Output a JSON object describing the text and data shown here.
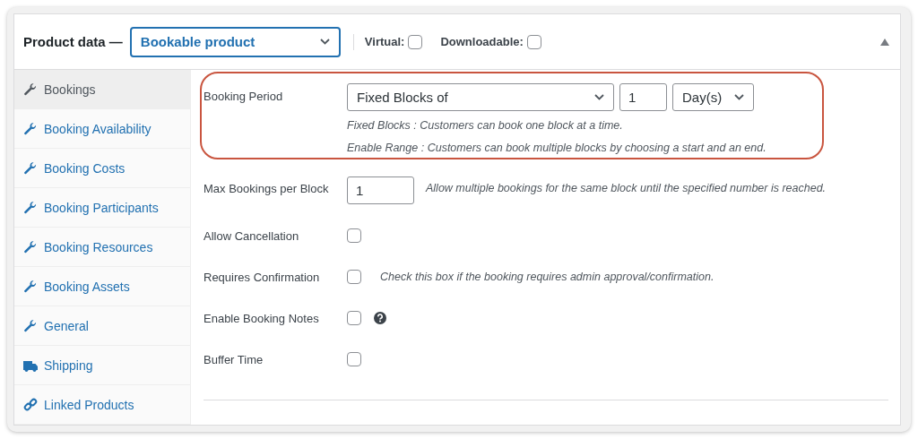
{
  "header": {
    "title": "Product data —",
    "product_type": "Bookable product",
    "options": [
      {
        "label": "Virtual:",
        "checked": false
      },
      {
        "label": "Downloadable:",
        "checked": false
      }
    ],
    "expanded": true
  },
  "sidebar": {
    "items": [
      {
        "label": "Bookings",
        "kind": "wrench",
        "selected": true
      },
      {
        "label": "Booking Availability",
        "kind": "wrench",
        "selected": false
      },
      {
        "label": "Booking Costs",
        "kind": "wrench",
        "selected": false
      },
      {
        "label": "Booking Participants",
        "kind": "wrench",
        "selected": false
      },
      {
        "label": "Booking Resources",
        "kind": "wrench",
        "selected": false
      },
      {
        "label": "Booking Assets",
        "kind": "wrench",
        "selected": false
      },
      {
        "label": "General",
        "kind": "wrench",
        "selected": false
      },
      {
        "label": "Shipping",
        "kind": "truck",
        "selected": false
      },
      {
        "label": "Linked Products",
        "kind": "link",
        "selected": false
      }
    ]
  },
  "fields": [
    {
      "kind": "period",
      "label": "Booking Period",
      "highlighted": true,
      "period_type": "Fixed Blocks of",
      "block_value": "1",
      "unit": "Day(s)",
      "notes": [
        "Fixed Blocks : Customers can book one block at a time.",
        "Enable Range : Customers can book multiple blocks by choosing a start and an end."
      ]
    },
    {
      "kind": "number",
      "label": "Max Bookings per Block",
      "value": "1",
      "description": "Allow multiple bookings for the same block until the specified number is reached."
    },
    {
      "kind": "checkbox",
      "label": "Allow Cancellation",
      "checked": false
    },
    {
      "kind": "checkbox",
      "label": "Requires Confirmation",
      "checked": false,
      "description": "Check this box if the booking requires admin approval/confirmation."
    },
    {
      "kind": "checkbox",
      "label": "Enable Booking Notes",
      "checked": false,
      "help": true
    },
    {
      "kind": "checkbox",
      "label": "Buffer Time",
      "checked": false
    }
  ]
}
